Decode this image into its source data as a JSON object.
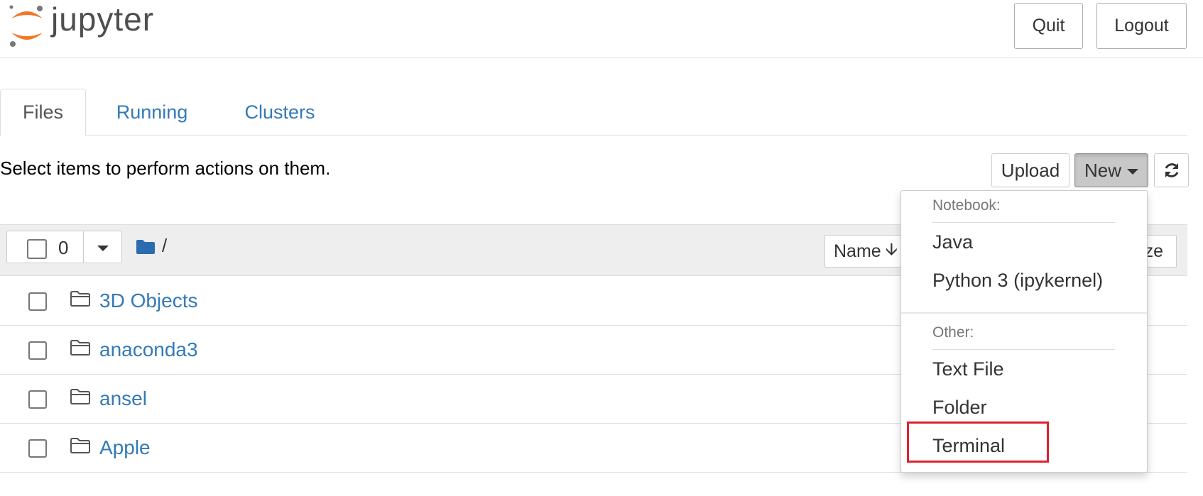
{
  "header": {
    "logo_text": "jupyter",
    "quit_label": "Quit",
    "logout_label": "Logout"
  },
  "tabs": [
    {
      "label": "Files",
      "active": true
    },
    {
      "label": "Running",
      "active": false
    },
    {
      "label": "Clusters",
      "active": false
    }
  ],
  "toolbar": {
    "hint": "Select items to perform actions on them.",
    "upload_label": "Upload",
    "new_label": "New",
    "refresh_icon": "refresh-icon"
  },
  "list_header": {
    "selected_count": "0",
    "breadcrumb": "/",
    "sort_name_label": "Name",
    "sort_size_partial": "ze"
  },
  "files": [
    {
      "name": "3D Objects",
      "type": "folder"
    },
    {
      "name": "anaconda3",
      "type": "folder"
    },
    {
      "name": "ansel",
      "type": "folder"
    },
    {
      "name": "Apple",
      "type": "folder"
    }
  ],
  "new_menu": {
    "notebook_header": "Notebook:",
    "notebook_items": [
      "Java",
      "Python 3 (ipykernel)"
    ],
    "other_header": "Other:",
    "other_items": [
      "Text File",
      "Folder",
      "Terminal"
    ],
    "highlighted_item": "Terminal",
    "highlight_color": "#e0202e"
  },
  "colors": {
    "link": "#337ab7",
    "logo_orange": "#f37726",
    "folder_blue": "#2b6cb0"
  }
}
